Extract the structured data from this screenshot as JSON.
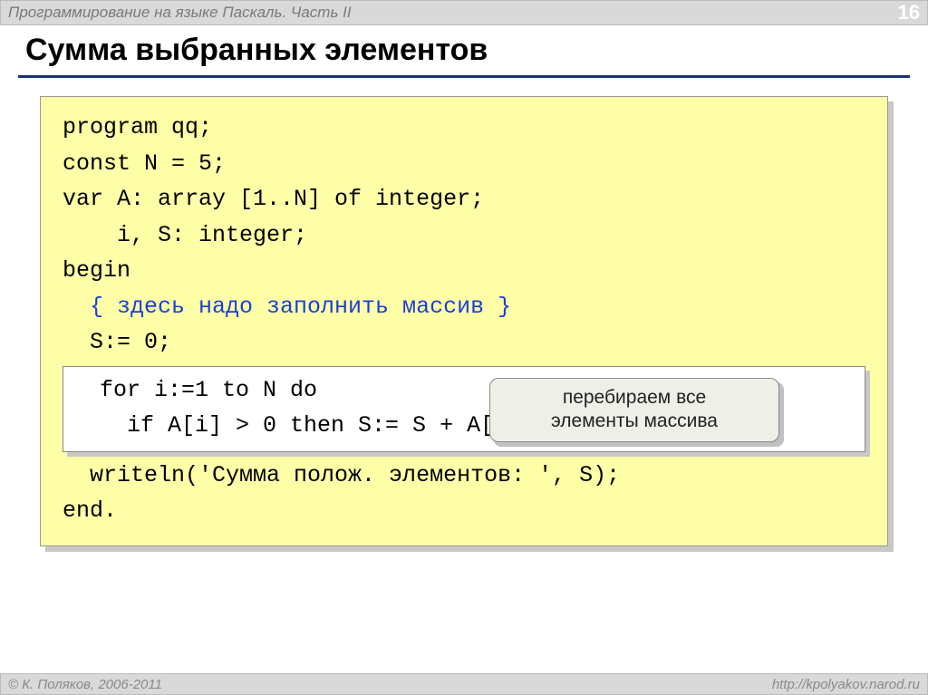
{
  "header": {
    "title": "Программирование на языке Паскаль. Часть II",
    "page_number": "16"
  },
  "slide_title": "Сумма выбранных элементов",
  "code": {
    "line1": "program qq;",
    "line2": "const N = 5;",
    "line3": "var A: array [1..N] of integer;",
    "line4": "    i, S: integer;",
    "line5": "begin",
    "comment": "  { здесь надо заполнить массив }",
    "line6": "  S:= 0;",
    "hl1": "  for i:=1 to N do",
    "hl2": "    if A[i] > 0 then S:= S + A[i];",
    "line7": "  writeln('Сумма полож. элементов: ', S);",
    "line8": "end."
  },
  "callout": {
    "line1": "перебираем все",
    "line2": "элементы массива"
  },
  "footer": {
    "left": "© К. Поляков, 2006-2011",
    "right": "http://kpolyakov.narod.ru"
  }
}
